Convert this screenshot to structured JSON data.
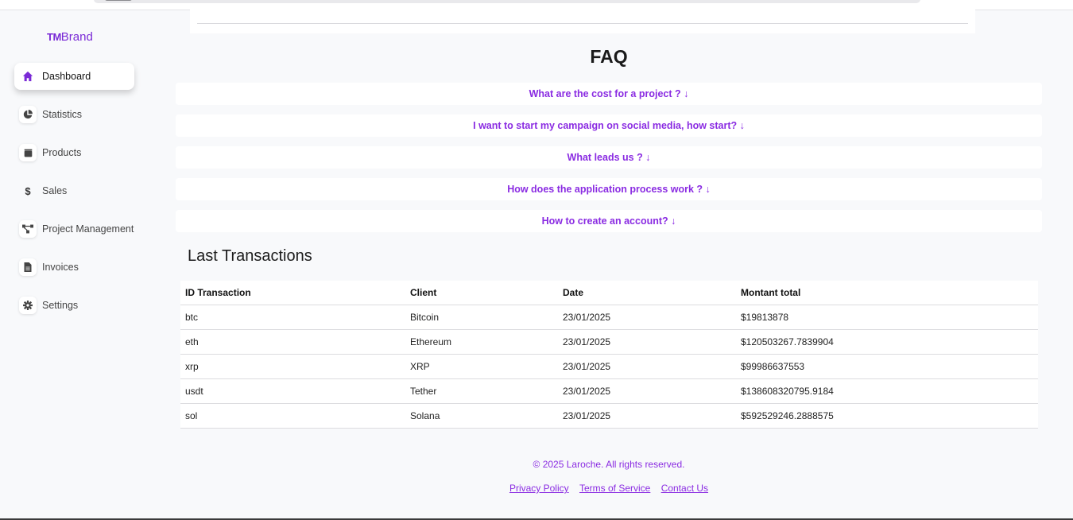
{
  "brand": {
    "prefix": "TM",
    "name": "Brand"
  },
  "sidebar": {
    "items": [
      {
        "label": "Dashboard",
        "icon": "home-icon"
      },
      {
        "label": "Statistics",
        "icon": "pie-chart-icon"
      },
      {
        "label": "Products",
        "icon": "box-icon"
      },
      {
        "label": "Sales",
        "icon": "dollar-icon"
      },
      {
        "label": "Project Management",
        "icon": "project-diagram-icon"
      },
      {
        "label": "Invoices",
        "icon": "invoice-icon"
      },
      {
        "label": "Settings",
        "icon": "gear-icon"
      }
    ]
  },
  "faq": {
    "title": "FAQ",
    "items": [
      "What are the cost for a project ? ↓",
      "I want to start my campaign on social media, how start? ↓",
      "What leads us ? ↓",
      "How does the application process work ? ↓",
      "How to create an account? ↓"
    ]
  },
  "transactions": {
    "title": "Last Transactions",
    "columns": [
      "ID Transaction",
      "Client",
      "Date",
      "Montant total"
    ],
    "rows": [
      [
        "btc",
        "Bitcoin",
        "23/01/2025",
        "$19813878"
      ],
      [
        "eth",
        "Ethereum",
        "23/01/2025",
        "$120503267.7839904"
      ],
      [
        "xrp",
        "XRP",
        "23/01/2025",
        "$99986637553"
      ],
      [
        "usdt",
        "Tether",
        "23/01/2025",
        "$138608320795.9184"
      ],
      [
        "sol",
        "Solana",
        "23/01/2025",
        "$592529246.2888575"
      ]
    ]
  },
  "footer": {
    "copyright": "© 2025 Laroche. All rights reserved.",
    "links": [
      "Privacy Policy",
      "Terms of Service",
      "Contact Us"
    ]
  },
  "colors": {
    "accent": "#8a2be2",
    "background": "#f8f9fb"
  }
}
